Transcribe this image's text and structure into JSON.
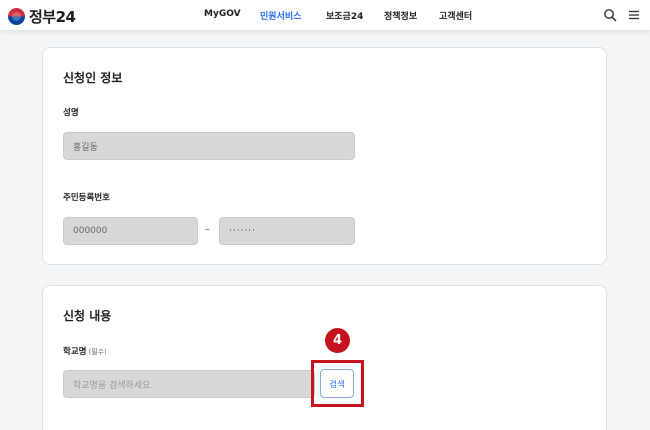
{
  "header": {
    "logo_text": "정부24",
    "nav": [
      {
        "label": "MyGOV",
        "active": false
      },
      {
        "label": "민원서비스",
        "active": true
      },
      {
        "label": "보조금24",
        "active": false
      },
      {
        "label": "정책정보",
        "active": false
      },
      {
        "label": "고객센터",
        "active": false
      }
    ],
    "icons": [
      "search-icon",
      "menu-icon"
    ]
  },
  "applicant": {
    "title": "신청인 정보",
    "name_label": "성명",
    "name_value": "홍길동",
    "rrn_label": "주민등록번호",
    "rrn_front": "000000",
    "rrn_separator": "–",
    "rrn_back": "·······"
  },
  "application": {
    "title": "신청 내용",
    "school_label": "학교명",
    "school_required": "(필수)",
    "school_placeholder": "학교명을 검색하세요.",
    "search_button": "검색"
  },
  "annotation": {
    "step_number": "4",
    "color": "#c4121e"
  },
  "colors": {
    "accent": "#256ef4",
    "input_bg": "#d8d8d8"
  }
}
